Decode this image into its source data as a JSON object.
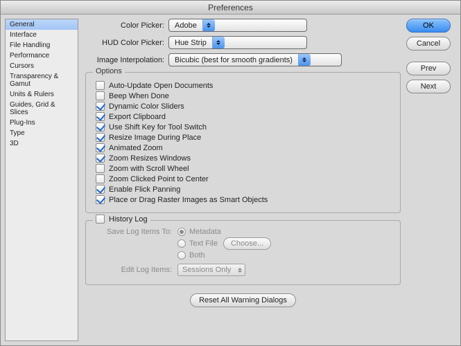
{
  "window": {
    "title": "Preferences"
  },
  "sidebar": {
    "items": [
      {
        "label": "General",
        "active": true
      },
      {
        "label": "Interface"
      },
      {
        "label": "File Handling"
      },
      {
        "label": "Performance"
      },
      {
        "label": "Cursors"
      },
      {
        "label": "Transparency & Gamut"
      },
      {
        "label": "Units & Rulers"
      },
      {
        "label": "Guides, Grid & Slices"
      },
      {
        "label": "Plug-Ins"
      },
      {
        "label": "Type"
      },
      {
        "label": "3D"
      }
    ]
  },
  "buttons": {
    "ok": "OK",
    "cancel": "Cancel",
    "prev": "Prev",
    "next": "Next"
  },
  "pickers": {
    "color_label": "Color Picker:",
    "color_value": "Adobe",
    "hud_label": "HUD Color Picker:",
    "hud_value": "Hue Strip",
    "interp_label": "Image Interpolation:",
    "interp_value": "Bicubic (best for smooth gradients)"
  },
  "options": {
    "legend": "Options",
    "items": [
      {
        "label": "Auto-Update Open Documents",
        "checked": false
      },
      {
        "label": "Beep When Done",
        "checked": false
      },
      {
        "label": "Dynamic Color Sliders",
        "checked": true
      },
      {
        "label": "Export Clipboard",
        "checked": true
      },
      {
        "label": "Use Shift Key for Tool Switch",
        "checked": true
      },
      {
        "label": "Resize Image During Place",
        "checked": true
      },
      {
        "label": "Animated Zoom",
        "checked": true
      },
      {
        "label": "Zoom Resizes Windows",
        "checked": true
      },
      {
        "label": "Zoom with Scroll Wheel",
        "checked": false
      },
      {
        "label": "Zoom Clicked Point to Center",
        "checked": false
      },
      {
        "label": "Enable Flick Panning",
        "checked": true
      },
      {
        "label": "Place or Drag Raster Images as Smart Objects",
        "checked": true
      }
    ]
  },
  "history": {
    "legend": "History Log",
    "save_label": "Save Log Items To:",
    "radios": [
      {
        "label": "Metadata",
        "selected": true
      },
      {
        "label": "Text File",
        "selected": false
      },
      {
        "label": "Both",
        "selected": false
      }
    ],
    "choose": "Choose...",
    "edit_label": "Edit Log Items:",
    "edit_value": "Sessions Only"
  },
  "reset": "Reset All Warning Dialogs"
}
